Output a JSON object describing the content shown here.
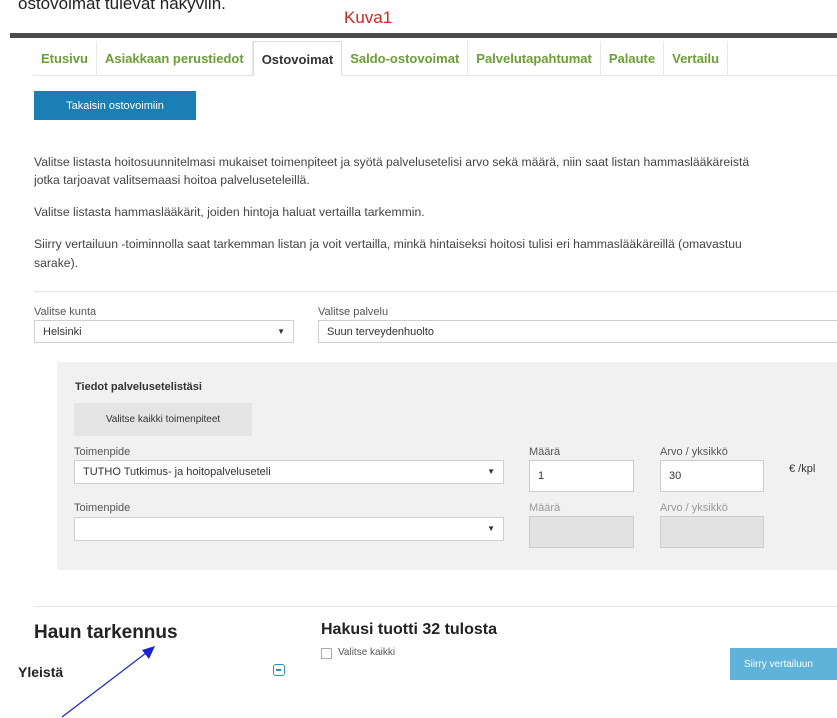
{
  "page_caption_top": "     ostovoimat tulevat näkyviin.",
  "caption": "Kuva1",
  "tabs": [
    {
      "label": "Etusivu"
    },
    {
      "label": "Asiakkaan perustiedot"
    },
    {
      "label": "Ostovoimat",
      "active": true
    },
    {
      "label": "Saldo-ostovoimat"
    },
    {
      "label": "Palvelutapahtumat"
    },
    {
      "label": "Palaute"
    },
    {
      "label": "Vertailu"
    }
  ],
  "back_button": "Takaisin ostovoimiin",
  "paragraphs": {
    "p1a": "Valitse listasta hoitosuunnitelmasi mukaiset toimenpiteet ja syötä palvelusetelisi arvo sekä määrä, niin saat listan hammaslääkäreistä",
    "p1b": "jotka tarjoavat valitsemaasi hoitoa palveluseteleillä.",
    "p2": "Valitse listasta hammaslääkärit, joiden hintoja haluat vertailla tarkemmin.",
    "p3a": "Siirry vertailuun -toiminnolla saat tarkemman listan ja voit vertailla, minkä hintaiseksi hoitosi tulisi eri hammaslääkäreillä (omavastuu",
    "p3b": "sarake)."
  },
  "filters": {
    "kunta_label": "Valitse kunta",
    "kunta_value": "Helsinki",
    "palvelu_label": "Valitse palvelu",
    "palvelu_value": "Suun terveydenhuolto"
  },
  "voucher_panel": {
    "title": "Tiedot palvelusetelistäsi",
    "select_all_button": "Valitse kaikki toimenpiteet",
    "rows": [
      {
        "toimenpide_label": "Toimenpide",
        "toimenpide_value": "TUTHO Tutkimus- ja hoitopalveluseteli",
        "maara_label": "Määrä",
        "maara_value": "1",
        "arvo_label": "Arvo / yksikkö",
        "arvo_value": "30",
        "unit": "€ /kpl"
      },
      {
        "toimenpide_label": "Toimenpide",
        "toimenpide_value": "",
        "maara_label": "Määrä",
        "maara_value": "",
        "arvo_label": "Arvo / yksikkö",
        "arvo_value": ""
      }
    ]
  },
  "refine": {
    "title": "Haun tarkennus",
    "section": "Yleistä"
  },
  "results": {
    "count_text": "Hakusi tuotti 32 tulosta",
    "select_all": "Valitse kaikki",
    "compare_button": "Siirry vertailuun"
  },
  "colors": {
    "tab_green": "#6aa033",
    "primary_blue": "#1a7fb4",
    "caption_red": "#e0201b",
    "arrow_blue": "#1a22d6"
  }
}
